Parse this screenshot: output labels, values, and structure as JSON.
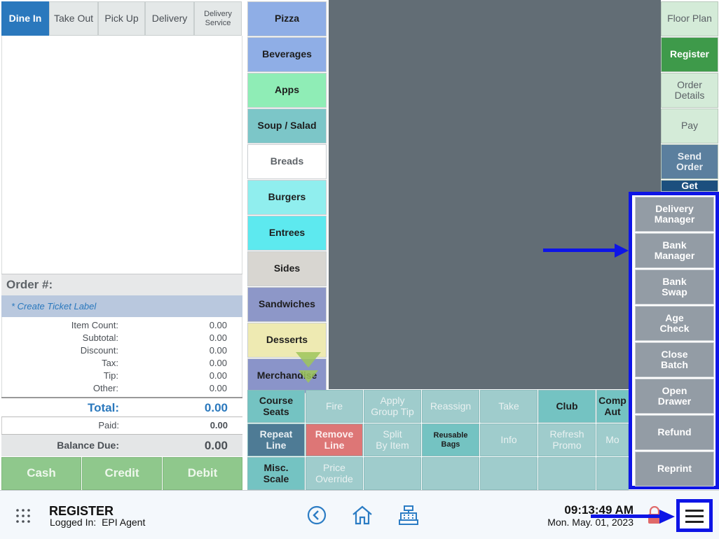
{
  "order_types": [
    {
      "label": "Dine In",
      "active": true
    },
    {
      "label": "Take Out"
    },
    {
      "label": "Pick Up"
    },
    {
      "label": "Delivery"
    },
    {
      "label": "Delivery\nService"
    }
  ],
  "ticket": {
    "order_label": "Order #:",
    "create_label": "* Create Ticket Label",
    "rows": [
      {
        "label": "Item Count:",
        "value": "0.00"
      },
      {
        "label": "Subtotal:",
        "value": "0.00"
      },
      {
        "label": "Discount:",
        "value": "0.00"
      },
      {
        "label": "Tax:",
        "value": "0.00"
      },
      {
        "label": "Tip:",
        "value": "0.00"
      },
      {
        "label": "Other:",
        "value": "0.00"
      }
    ],
    "total_label": "Total:",
    "total_value": "0.00",
    "paid_label": "Paid:",
    "paid_value": "0.00",
    "balance_label": "Balance Due:",
    "balance_value": "0.00"
  },
  "payment_buttons": [
    "Cash",
    "Credit",
    "Debit"
  ],
  "categories": [
    {
      "label": "Pizza",
      "color": "#8faee6"
    },
    {
      "label": "Beverages",
      "color": "#8faee6"
    },
    {
      "label": "Apps",
      "color": "#8fedb6"
    },
    {
      "label": "Soup / Salad",
      "color": "#7cc6c8"
    },
    {
      "label": "Breads",
      "color": "#ffffff"
    },
    {
      "label": "Burgers",
      "color": "#90eeee"
    },
    {
      "label": "Entrees",
      "color": "#5de9ef"
    },
    {
      "label": "Sides",
      "color": "#d8d6d1"
    },
    {
      "label": "Sandwiches",
      "color": "#8d97c8"
    },
    {
      "label": "Desserts",
      "color": "#eeeab2"
    },
    {
      "label": "Merchandise",
      "color": "#8a94c9"
    }
  ],
  "functions": {
    "row1": [
      "Course\nSeats",
      "Fire",
      "Apply\nGroup Tip",
      "Reassign",
      "Take",
      "Club",
      "Comp\nAut"
    ],
    "row2": [
      "Repeat\nLine",
      "Remove\nLine",
      "Split\nBy Item",
      "Reusable\nBags",
      "Info",
      "Refresh\nPromo",
      "Mo"
    ],
    "row3": [
      "Misc.\nScale",
      "Price\nOverride",
      "",
      "",
      "",
      "",
      ""
    ]
  },
  "right_buttons": [
    {
      "label": "Floor Plan",
      "bg": "#d4ebd8",
      "fg": "#5b6166"
    },
    {
      "label": "Register",
      "bg": "#3e9a4a",
      "fg": "#ffffff"
    },
    {
      "label": "Order\nDetails",
      "bg": "#d4ebd8",
      "fg": "#5b6166"
    },
    {
      "label": "Pay",
      "bg": "#d4ebd8",
      "fg": "#5b6166"
    },
    {
      "label": "Send\nOrder",
      "bg": "#5b7f9e",
      "fg": "#e9eef3"
    },
    {
      "label": "Get",
      "bg": "#1c4f7e",
      "fg": "#ffffff"
    }
  ],
  "overlay_menu": [
    "Delivery\nManager",
    "Bank\nManager",
    "Bank\nSwap",
    "Age\nCheck",
    "Close\nBatch",
    "Open\nDrawer",
    "Refund",
    "Reprint"
  ],
  "footer": {
    "title": "REGISTER",
    "logged_in_label": "Logged In:",
    "user": "EPI Agent",
    "time": "09:13:49 AM",
    "date": "Mon. May. 01, 2023"
  },
  "icons": {
    "apps": "grid-dots-icon",
    "back": "back-circle-icon",
    "home": "home-icon",
    "register": "cash-register-icon",
    "lock": "lock-icon",
    "menu": "hamburger-menu-icon"
  },
  "colors": {
    "accent_blue": "#2a78bd",
    "highlight": "#0e15e6",
    "register_green": "#3e9a4a"
  }
}
